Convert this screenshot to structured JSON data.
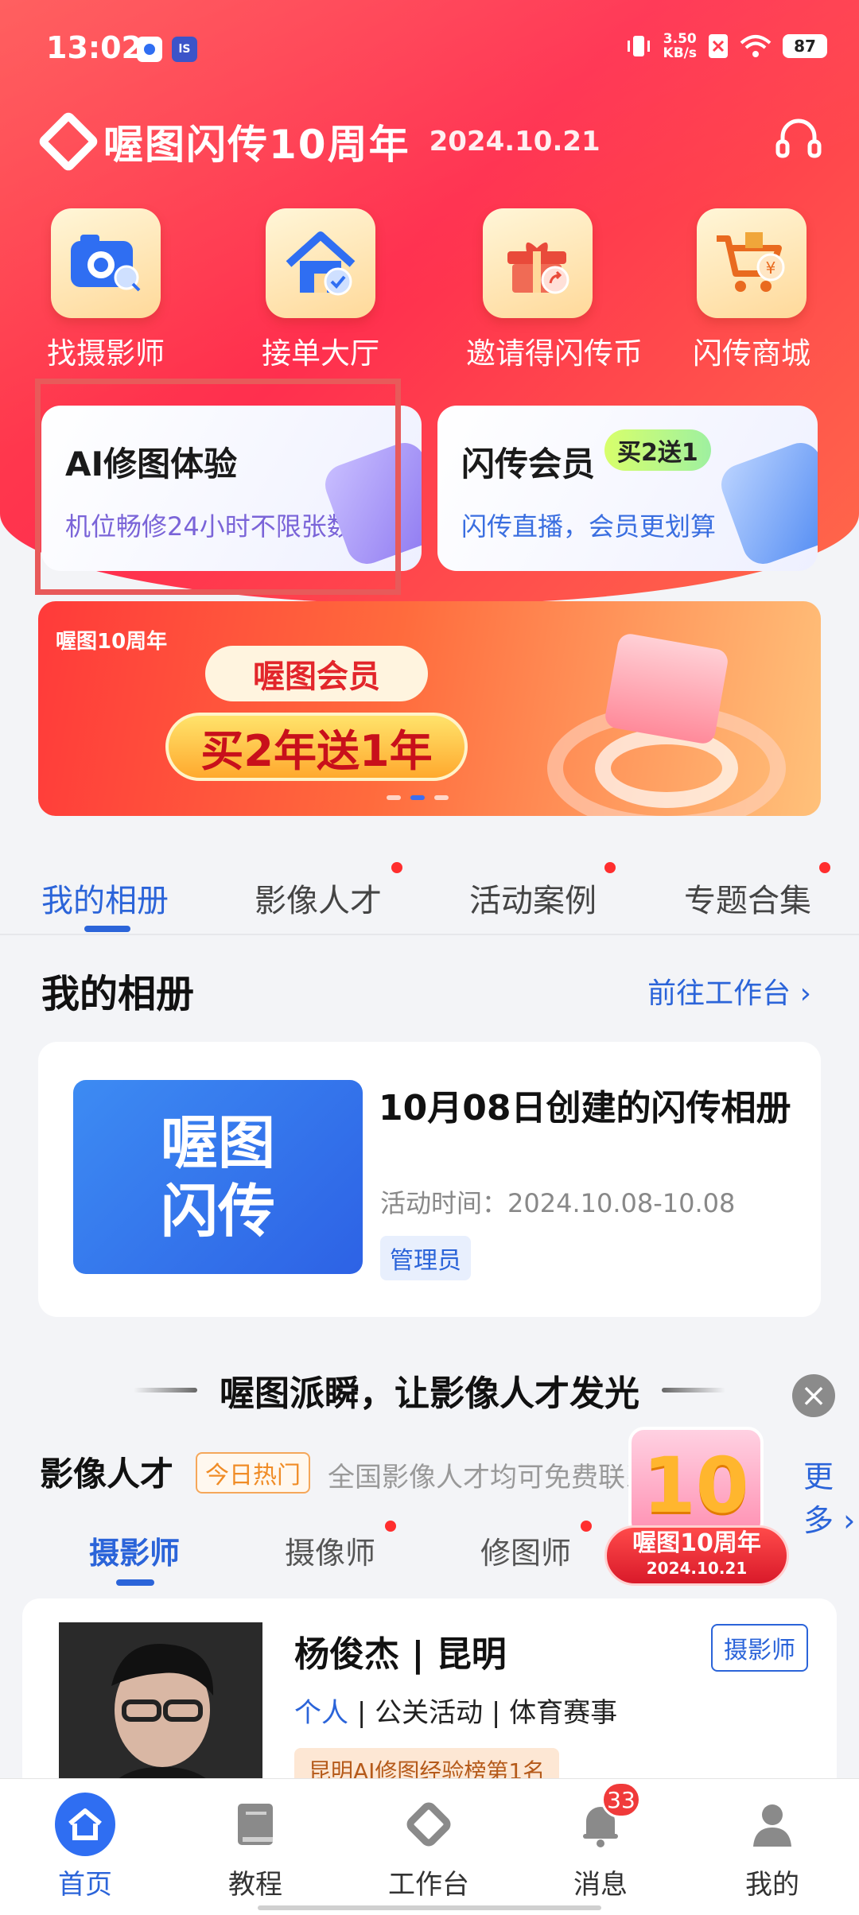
{
  "status_bar": {
    "time": "13:02",
    "net_speed": "3.50",
    "net_unit": "KB/s",
    "battery": "87",
    "chip2_text": "lS"
  },
  "header": {
    "brand": "喔图闪传10周年",
    "date": "2024.10.21"
  },
  "quick_actions": [
    {
      "label": "找摄影师",
      "icon": "camera-search-icon"
    },
    {
      "label": "接单大厅",
      "icon": "house-check-icon"
    },
    {
      "label": "邀请得闪传币",
      "icon": "gift-share-icon"
    },
    {
      "label": "闪传商城",
      "icon": "shopping-cart-icon"
    }
  ],
  "promo_cards": [
    {
      "title": "AI修图体验",
      "subtitle": "机位畅修24小时不限张数",
      "subtitle_color": "#7a64d8"
    },
    {
      "title": "闪传会员",
      "badge": "买2送1",
      "subtitle": "闪传直播，会员更划算",
      "subtitle_color": "#3a6ee0"
    }
  ],
  "banner": {
    "brand": "喔图10周年",
    "title": "喔图会员",
    "offer": "买2年送1年"
  },
  "tabs": [
    {
      "label": "我的相册",
      "active": true
    },
    {
      "label": "影像人才",
      "dot": true
    },
    {
      "label": "活动案例",
      "dot": true
    },
    {
      "label": "专题合集",
      "dot": true
    }
  ],
  "album_section": {
    "title": "我的相册",
    "link": "前往工作台 ›"
  },
  "album": {
    "thumb_text_1": "喔图",
    "thumb_text_2": "闪传",
    "title": "10月08日创建的闪传相册",
    "time": "活动时间：2024.10.08-10.08",
    "role": "管理员"
  },
  "slogan": "喔图派瞬，让影像人才发光",
  "talent": {
    "title": "影像人才",
    "hot_tag": "今日热门",
    "desc": "全国影像人才均可免费联系",
    "more": "更多 ›",
    "sub_tabs": [
      {
        "label": "摄影师",
        "active": true
      },
      {
        "label": "摄像师",
        "dot": true
      },
      {
        "label": "修图师",
        "dot": true
      }
    ]
  },
  "gift": {
    "number": "10",
    "line1": "喔图10周年",
    "line2": "2024.10.21"
  },
  "person": {
    "name": "杨俊杰 | 昆明",
    "tag": "摄影师",
    "type": "个人",
    "categories": "| 公关活动 | 体育赛事",
    "award": "昆明AI修图经验榜第1名"
  },
  "bottom_nav": [
    {
      "label": "首页",
      "active": true,
      "icon": "home-icon"
    },
    {
      "label": "教程",
      "icon": "book-icon"
    },
    {
      "label": "工作台",
      "icon": "workbench-icon"
    },
    {
      "label": "消息",
      "icon": "bell-icon",
      "badge": "33"
    },
    {
      "label": "我的",
      "icon": "profile-icon"
    }
  ],
  "colors": {
    "accent": "#2b64d9",
    "header_red": "#ff3b4e"
  }
}
